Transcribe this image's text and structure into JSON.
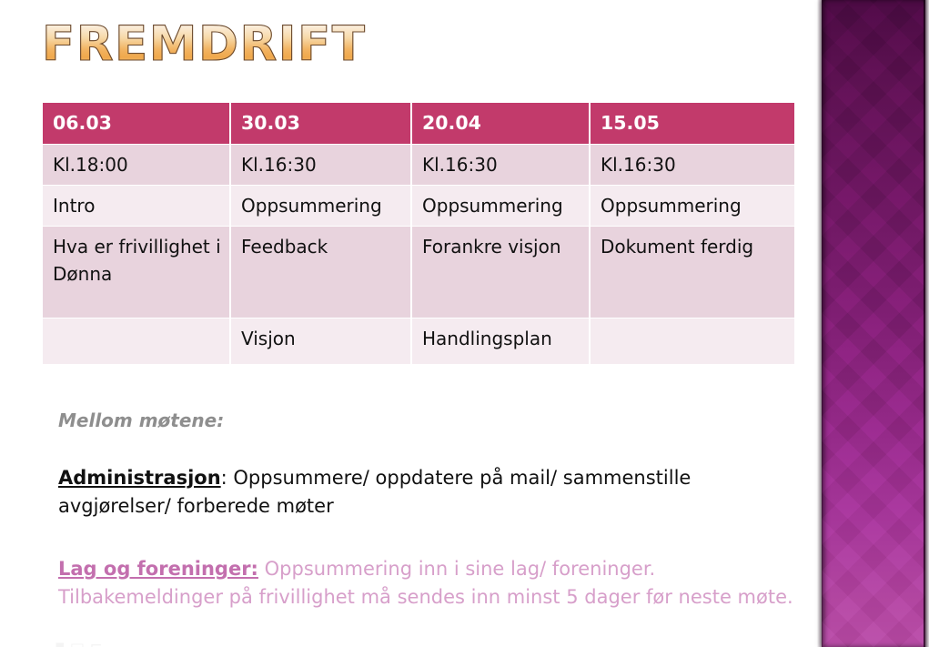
{
  "slide": {
    "title": "Fremdrift",
    "background_color": "#ffffff",
    "accent_color": "#c23a6b",
    "side_band_color_top": "#4b0a43",
    "side_band_color_bottom": "#b64ba4"
  },
  "table": {
    "headers": [
      "06.03",
      "30.03",
      "20.04",
      "15.05"
    ],
    "rows": [
      [
        "Kl.18:00",
        "Kl.16:30",
        "Kl.16:30",
        "Kl.16:30"
      ],
      [
        "Intro",
        "Oppsummering",
        "Oppsummering",
        "Oppsummering"
      ],
      [
        "Hva er frivillighet i Dønna",
        "Feedback",
        "Forankre visjon",
        "Dokument ferdig"
      ],
      [
        "",
        "Visjon",
        "Handlingsplan",
        ""
      ]
    ],
    "header_bg": "#c23a6b",
    "row_dark_bg": "#e8d3dd",
    "row_light_bg": "#f5ebf0"
  },
  "body": {
    "lead": "Mellom møtene:",
    "admin": {
      "term": "Administrasjon",
      "rest": ": Oppsummere/ oppdatere på mail/ sammenstille avgjørelser/ forberede møter"
    },
    "lag": {
      "term": "Lag og foreninger:",
      "rest": " Oppsummering inn i sine lag/ foreninger. Tilbakemeldinger på  frivillighet må sendes inn minst 5 dager før neste møte."
    }
  },
  "artifact": {
    "text": "▪ ▭ ⌐"
  }
}
